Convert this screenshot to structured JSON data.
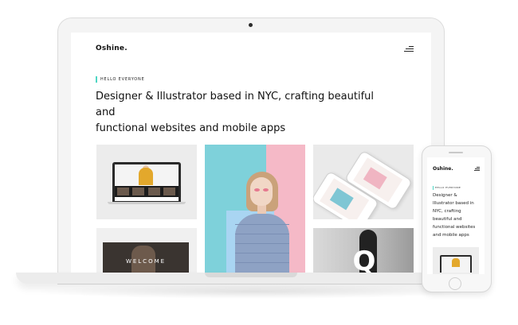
{
  "site": {
    "logo": "Oshine.",
    "eyebrow": "HELLO EVERYONE",
    "headline_line1": "Designer & Illustrator based in NYC, crafting beautiful and",
    "headline_line2": "functional websites and mobile apps"
  },
  "portfolio": {
    "welcome_text": "WELCOME",
    "q_letter": "Q"
  },
  "mobile": {
    "logo": "Oshine.",
    "eyebrow": "HELLO EVERYONE",
    "headline_lines": [
      "Designer &",
      "Illustrator based in",
      "NYC, crafting",
      "beautiful and",
      "functional websites",
      "and mobile apps"
    ]
  },
  "colors": {
    "accent": "#4fd6c4",
    "teal": "#7ed1da",
    "pink": "#f5b9c7"
  },
  "icons": {
    "menu": "hamburger-menu-icon",
    "mobile_menu": "hamburger-menu-icon"
  }
}
